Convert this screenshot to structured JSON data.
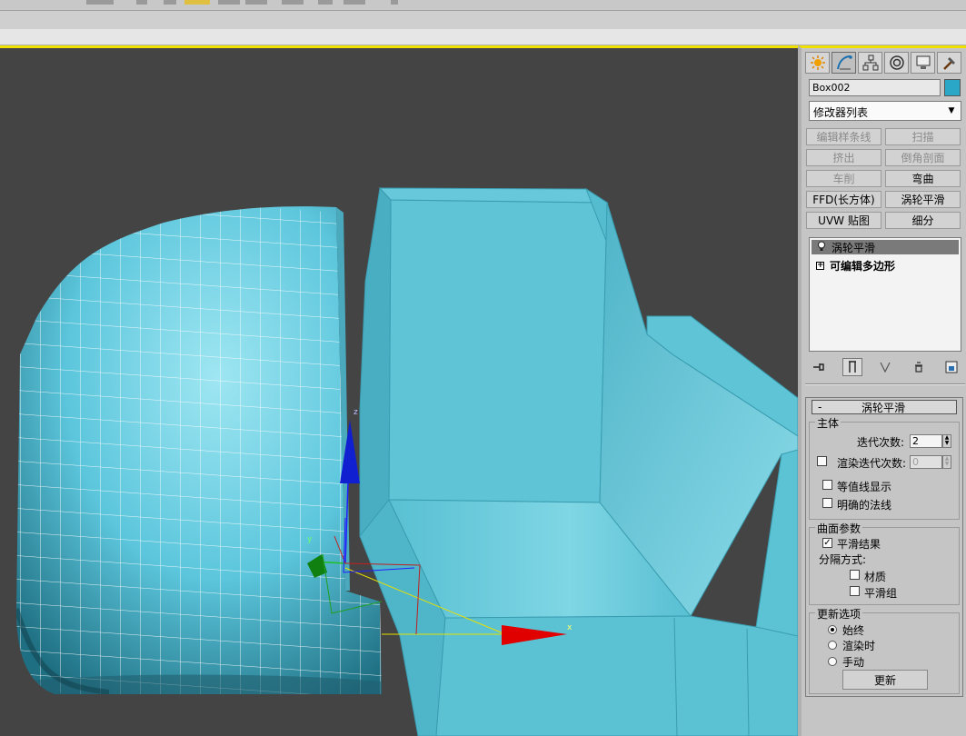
{
  "panel": {
    "tabs": [
      {
        "icon": "create-sun-icon"
      },
      {
        "icon": "modify-curve-icon"
      },
      {
        "icon": "hierarchy-icon"
      },
      {
        "icon": "motion-icon"
      },
      {
        "icon": "display-monitor-icon"
      },
      {
        "icon": "utilities-hammer-icon"
      }
    ],
    "object_name": "Box002",
    "object_color": "#2aa6c6",
    "modifier_list": "修改器列表",
    "modifier_buttons": [
      {
        "label": "编辑样条线",
        "enabled": false
      },
      {
        "label": "扫描",
        "enabled": false
      },
      {
        "label": "挤出",
        "enabled": false
      },
      {
        "label": "倒角剖面",
        "enabled": false
      },
      {
        "label": "车削",
        "enabled": false
      },
      {
        "label": "弯曲",
        "enabled": true
      },
      {
        "label": "FFD(长方体)",
        "enabled": true
      },
      {
        "label": "涡轮平滑",
        "enabled": true
      },
      {
        "label": "UVW 贴图",
        "enabled": true
      },
      {
        "label": "细分",
        "enabled": true
      }
    ],
    "stack": {
      "top": "涡轮平滑",
      "base": "可编辑多边形",
      "expand": "+"
    },
    "rollout": {
      "collapse": "-",
      "title": "涡轮平滑",
      "main_group": "主体",
      "iterations_label": "迭代次数:",
      "iterations_value": "2",
      "render_iters_label": "渲染迭代次数:",
      "render_iters_value": "0",
      "isoline": "等值线显示",
      "explicit_normals": "明确的法线",
      "surface_group": "曲面参数",
      "smooth_result": "平滑结果",
      "separate_by": "分隔方式:",
      "materials": "材质",
      "smoothing_groups": "平滑组",
      "update_group": "更新选项",
      "always": "始终",
      "when_rendering": "渲染时",
      "manually": "手动",
      "update_button": "更新"
    }
  },
  "viewport": {
    "gizmo_z": "z",
    "gizmo_y": "y",
    "gizmo_x": "x"
  }
}
